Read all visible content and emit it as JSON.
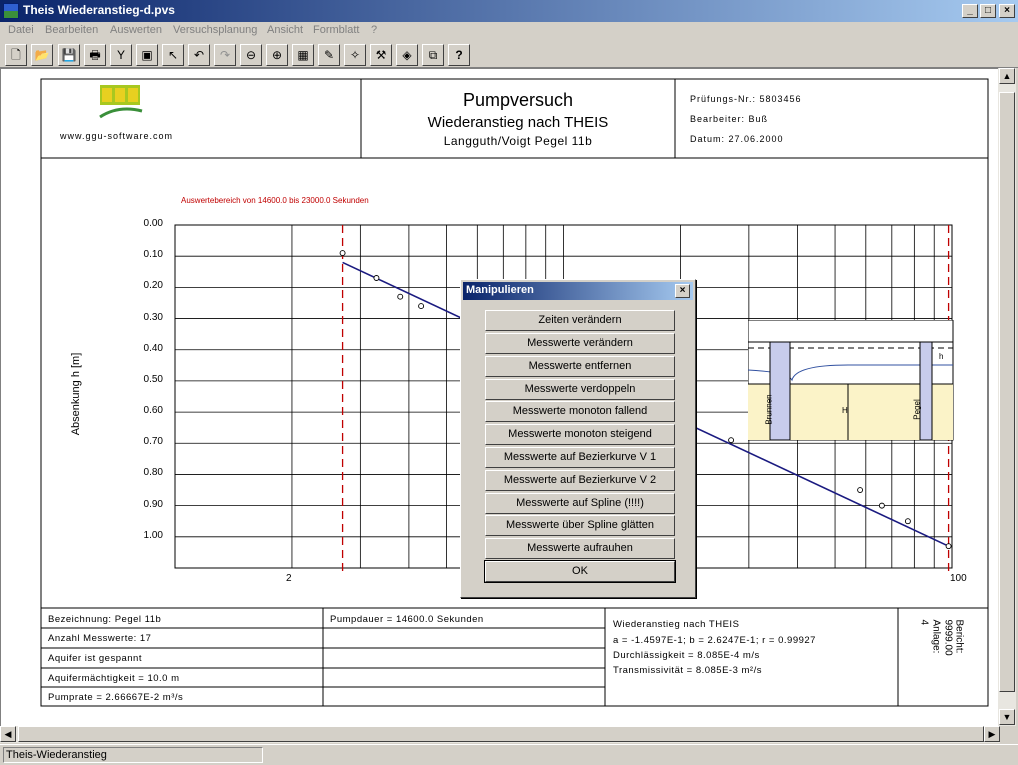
{
  "window": {
    "title": "Theis Wiederanstieg-d.pvs",
    "minimize": "_",
    "maximize": "□",
    "close": "×"
  },
  "menu": [
    "Datei",
    "Bearbeiten",
    "Auswerten",
    "Versuchsplanung",
    "Ansicht",
    "Formblatt",
    "?"
  ],
  "toolbar": [
    "new-doc",
    "open-folder",
    "save",
    "print",
    "info",
    "page-setup",
    "pointer",
    "undo",
    "redo",
    "zoom-out",
    "zoom-in",
    "table",
    "edit-sheet",
    "bulb",
    "tools",
    "eraser",
    "copy",
    "help"
  ],
  "toolbar_glyphs": [
    "🗋",
    "📂",
    "💾",
    "🖶",
    "Y",
    "▣",
    "↖",
    "↶",
    "↷",
    "⊖",
    "⊕",
    "▦",
    "✎",
    "✧",
    "⚒",
    "◈",
    "⧉",
    "?"
  ],
  "report": {
    "logo_url": "www.ggu-software.com",
    "logo_text": "GGU Software",
    "title": "Pumpversuch",
    "subtitle": "Wiederanstieg nach THEIS",
    "subtitle2": "Langguth/Voigt Pegel 11b",
    "pruefnr": "Prüfungs-Nr.: 5803456",
    "bearbeiter": "Bearbeiter: Buß",
    "datum": "Datum: 27.06.2000",
    "range_note": "Auswertebereich von 14600.0 bis 23000.0 Sekunden",
    "info_left": [
      "Bezeichnung: Pegel 11b",
      "Anzahl Messwerte: 17",
      "Aquifer ist gespannt",
      "Aquifermächtigkeit = 10.0 m",
      "Pumprate = 2.66667E-2 m³/s"
    ],
    "info_mid": [
      "Pumpdauer = 14600.0 Sekunden"
    ],
    "info_result": [
      "Wiederanstieg nach THEIS",
      "a = -1.4597E-1; b = 2.6247E-1; r = 0.99927",
      "Durchlässigkeit = 8.085E-4 m/s",
      "Transmissivität = 8.085E-3 m²/s"
    ],
    "bericht": "Bericht:",
    "bericht_nr": "9999.00",
    "anlage": "Anlage:",
    "anlage_nr": "4",
    "inset_labels": {
      "brunnen": "Brunnen",
      "pegel": "Pegel",
      "H": "H",
      "h": "h"
    }
  },
  "chart_data": {
    "type": "scatter",
    "xscale": "log",
    "xlim": [
      1,
      100
    ],
    "ylim": [
      0.0,
      1.1
    ],
    "yinvert": true,
    "ylabel": "Absenkung h [m]",
    "xtick_labels": [
      "2",
      "100"
    ],
    "ytick_labels": [
      "0.00",
      "0.10",
      "0.20",
      "0.30",
      "0.40",
      "0.50",
      "0.60",
      "0.70",
      "0.80",
      "0.90",
      "1.00"
    ],
    "points": [
      {
        "x": 2.7,
        "y": 0.09
      },
      {
        "x": 3.3,
        "y": 0.17
      },
      {
        "x": 3.8,
        "y": 0.23
      },
      {
        "x": 4.3,
        "y": 0.26
      },
      {
        "x": 27,
        "y": 0.69
      },
      {
        "x": 58,
        "y": 0.85
      },
      {
        "x": 66,
        "y": 0.9
      },
      {
        "x": 77,
        "y": 0.95
      },
      {
        "x": 98,
        "y": 1.03
      }
    ],
    "regression_line": [
      {
        "x": 2.7,
        "y": 0.12
      },
      {
        "x": 98,
        "y": 1.03
      }
    ],
    "range_markers_x": [
      2.7,
      98
    ]
  },
  "dialog": {
    "title": "Manipulieren",
    "close": "×",
    "buttons": [
      "Zeiten verändern",
      "Messwerte verändern",
      "Messwerte entfernen",
      "Messwerte verdoppeln",
      "Messwerte monoton fallend",
      "Messwerte monoton steigend",
      "Messwerte auf Bezierkurve V 1",
      "Messwerte auf Bezierkurve V 2",
      "Messwerte auf Spline (!!!!)",
      "Messwerte über Spline glätten",
      "Messwerte aufrauhen"
    ],
    "ok": "OK"
  },
  "scroll": {
    "up": "▲",
    "down": "▼",
    "left": "◀",
    "right": "▶"
  },
  "status": "Theis-Wiederanstieg",
  "colors": {
    "titlebar": "#0a246a",
    "line": "#1a1a80",
    "marker": "#c00000"
  }
}
